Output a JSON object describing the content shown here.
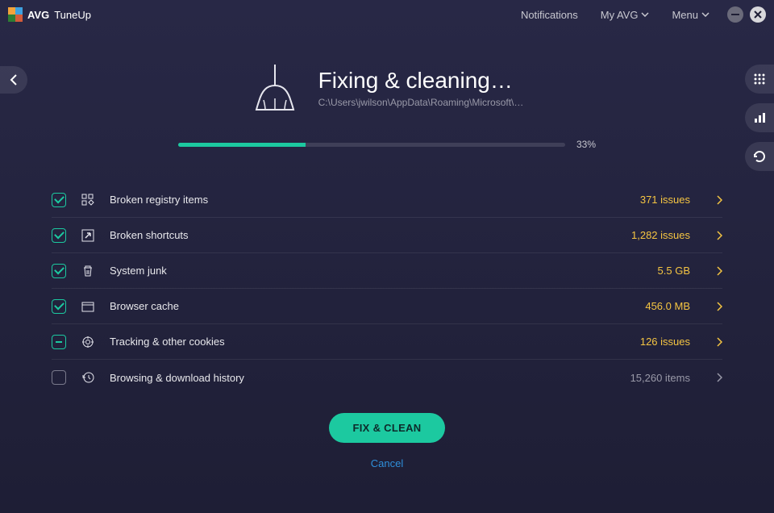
{
  "titlebar": {
    "brand_prefix": "AVG",
    "product": "TuneUp",
    "notifications": "Notifications",
    "my_avg": "My AVG",
    "menu": "Menu"
  },
  "logo_colors": [
    "#f3a33b",
    "#3ea1e0",
    "#2e7d32",
    "#d35c3a"
  ],
  "header": {
    "title": "Fixing & cleaning…",
    "subtitle": "C:\\Users\\jwilson\\AppData\\Roaming\\Microsoft\\…"
  },
  "progress": {
    "percent": 33,
    "label": "33%"
  },
  "rows": [
    {
      "id": "broken-registry",
      "label": "Broken registry items",
      "value": "371 issues",
      "state": "checked",
      "style": "warn",
      "icon": "grid"
    },
    {
      "id": "broken-shortcuts",
      "label": "Broken shortcuts",
      "value": "1,282 issues",
      "state": "checked",
      "style": "warn",
      "icon": "shortcut"
    },
    {
      "id": "system-junk",
      "label": "System junk",
      "value": "5.5 GB",
      "state": "checked",
      "style": "warn",
      "icon": "trash"
    },
    {
      "id": "browser-cache",
      "label": "Browser cache",
      "value": "456.0 MB",
      "state": "checked",
      "style": "warn",
      "icon": "browser"
    },
    {
      "id": "tracking-cookies",
      "label": "Tracking & other cookies",
      "value": "126 issues",
      "state": "partial",
      "style": "warn",
      "icon": "target"
    },
    {
      "id": "browsing-history",
      "label": "Browsing & download history",
      "value": "15,260 items",
      "state": "empty",
      "style": "dim",
      "icon": "history"
    }
  ],
  "actions": {
    "primary": "FIX & CLEAN",
    "cancel": "Cancel"
  },
  "colors": {
    "accent": "#1cc9a0",
    "warn": "#f5c542",
    "link": "#2f8fda"
  }
}
